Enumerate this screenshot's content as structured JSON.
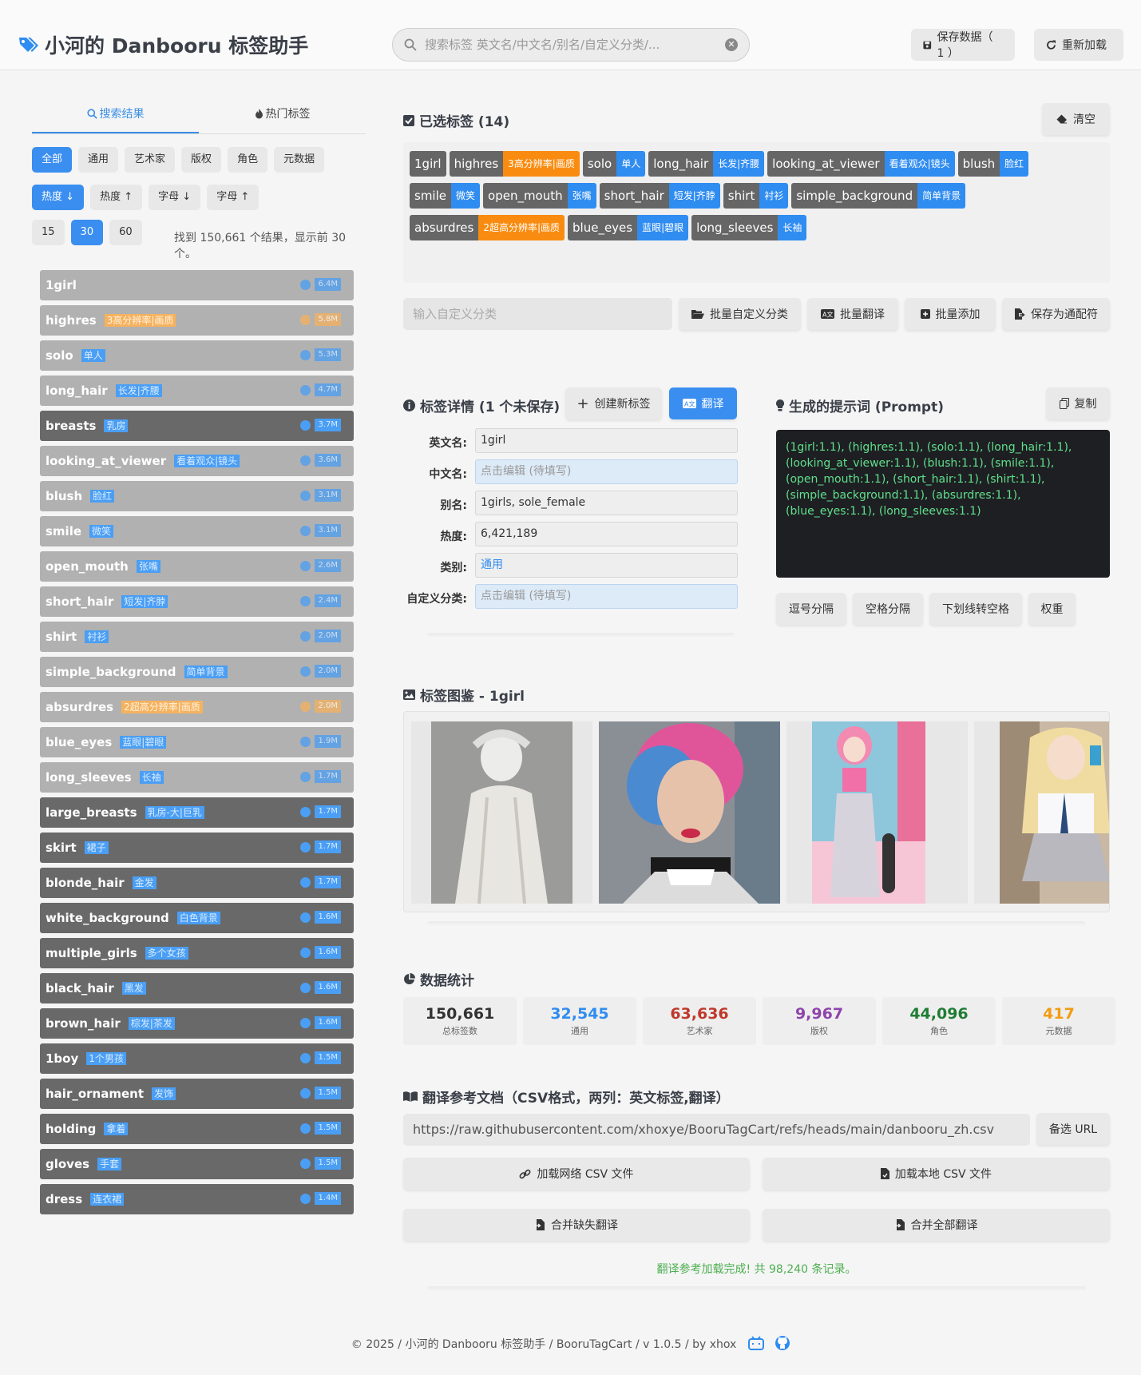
{
  "header": {
    "title": "小河的 Danbooru 标签助手",
    "search_placeholder": "搜索标签 英文名/中文名/别名/自定义分类/...",
    "save_label": "保存数据（ 1 ）",
    "reload_label": "重新加载"
  },
  "left": {
    "tabs": [
      "搜索结果",
      "热门标签"
    ],
    "categories": [
      "全部",
      "通用",
      "艺术家",
      "版权",
      "角色",
      "元数据"
    ],
    "sorts": [
      "热度",
      "热度",
      "字母",
      "字母"
    ],
    "page_sizes": [
      "15",
      "30",
      "60"
    ],
    "found_text": "找到 150,661 个结果，显示前 30 个。",
    "items": [
      {
        "en": "1girl",
        "zh": "",
        "count": "6.4M",
        "style": "light",
        "meta": false
      },
      {
        "en": "highres",
        "zh": "3高分辨率|画质",
        "count": "5.8M",
        "style": "light",
        "meta": true
      },
      {
        "en": "solo",
        "zh": "单人",
        "count": "5.3M",
        "style": "light",
        "meta": false
      },
      {
        "en": "long_hair",
        "zh": "长发|齐腰",
        "count": "4.7M",
        "style": "light",
        "meta": false
      },
      {
        "en": "breasts",
        "zh": "乳房",
        "count": "3.7M",
        "style": "dark",
        "meta": false
      },
      {
        "en": "looking_at_viewer",
        "zh": "看着观众|镜头",
        "count": "3.6M",
        "style": "light",
        "meta": false
      },
      {
        "en": "blush",
        "zh": "脸红",
        "count": "3.1M",
        "style": "light",
        "meta": false
      },
      {
        "en": "smile",
        "zh": "微笑",
        "count": "3.1M",
        "style": "light",
        "meta": false
      },
      {
        "en": "open_mouth",
        "zh": "张嘴",
        "count": "2.6M",
        "style": "light",
        "meta": false
      },
      {
        "en": "short_hair",
        "zh": "短发|齐脖",
        "count": "2.4M",
        "style": "light",
        "meta": false
      },
      {
        "en": "shirt",
        "zh": "衬衫",
        "count": "2.0M",
        "style": "light",
        "meta": false
      },
      {
        "en": "simple_background",
        "zh": "简单背景",
        "count": "2.0M",
        "style": "light",
        "meta": false
      },
      {
        "en": "absurdres",
        "zh": "2超高分辨率|画质",
        "count": "2.0M",
        "style": "light",
        "meta": true
      },
      {
        "en": "blue_eyes",
        "zh": "蓝眼|碧眼",
        "count": "1.9M",
        "style": "light",
        "meta": false
      },
      {
        "en": "long_sleeves",
        "zh": "长袖",
        "count": "1.7M",
        "style": "light",
        "meta": false
      },
      {
        "en": "large_breasts",
        "zh": "乳房-大|巨乳",
        "count": "1.7M",
        "style": "dark",
        "meta": false
      },
      {
        "en": "skirt",
        "zh": "裙子",
        "count": "1.7M",
        "style": "dark",
        "meta": false
      },
      {
        "en": "blonde_hair",
        "zh": "金发",
        "count": "1.7M",
        "style": "dark",
        "meta": false
      },
      {
        "en": "white_background",
        "zh": "白色背景",
        "count": "1.6M",
        "style": "dark",
        "meta": false
      },
      {
        "en": "multiple_girls",
        "zh": "多个女孩",
        "count": "1.6M",
        "style": "dark",
        "meta": false
      },
      {
        "en": "black_hair",
        "zh": "黑发",
        "count": "1.6M",
        "style": "dark",
        "meta": false
      },
      {
        "en": "brown_hair",
        "zh": "棕发|茶发",
        "count": "1.6M",
        "style": "dark",
        "meta": false
      },
      {
        "en": "1boy",
        "zh": "1个男孩",
        "count": "1.5M",
        "style": "dark",
        "meta": false
      },
      {
        "en": "hair_ornament",
        "zh": "发饰",
        "count": "1.5M",
        "style": "dark",
        "meta": false
      },
      {
        "en": "holding",
        "zh": "拿着",
        "count": "1.5M",
        "style": "dark",
        "meta": false
      },
      {
        "en": "gloves",
        "zh": "手套",
        "count": "1.5M",
        "style": "dark",
        "meta": false
      },
      {
        "en": "dress",
        "zh": "连衣裙",
        "count": "1.4M",
        "style": "dark",
        "meta": false
      }
    ]
  },
  "selected": {
    "title": "已选标签 (14)",
    "clear_label": "清空",
    "tags": [
      {
        "en": "1girl",
        "zh": "",
        "meta": false
      },
      {
        "en": "highres",
        "zh": "3高分辨率|画质",
        "meta": true
      },
      {
        "en": "solo",
        "zh": "单人",
        "meta": false
      },
      {
        "en": "long_hair",
        "zh": "长发|齐腰",
        "meta": false
      },
      {
        "en": "looking_at_viewer",
        "zh": "看着观众|镜头",
        "meta": false
      },
      {
        "en": "blush",
        "zh": "脸红",
        "meta": false
      },
      {
        "en": "smile",
        "zh": "微笑",
        "meta": false
      },
      {
        "en": "open_mouth",
        "zh": "张嘴",
        "meta": false
      },
      {
        "en": "short_hair",
        "zh": "短发|齐脖",
        "meta": false
      },
      {
        "en": "shirt",
        "zh": "衬衫",
        "meta": false
      },
      {
        "en": "simple_background",
        "zh": "简单背景",
        "meta": false
      },
      {
        "en": "absurdres",
        "zh": "2超高分辨率|画质",
        "meta": true
      },
      {
        "en": "blue_eyes",
        "zh": "蓝眼|碧眼",
        "meta": false
      },
      {
        "en": "long_sleeves",
        "zh": "长袖",
        "meta": false
      }
    ],
    "custom_placeholder": "输入自定义分类",
    "btn_batch_custom": "批量自定义分类",
    "btn_batch_translate": "批量翻译",
    "btn_batch_add": "批量添加",
    "btn_save_wildcard": "保存为通配符"
  },
  "detail": {
    "title": "标签详情 (1 个未保存)",
    "create_label": "创建新标签",
    "translate_label": "翻译",
    "labels": [
      "英文名:",
      "中文名:",
      "别名:",
      "热度:",
      "类别:",
      "自定义分类:"
    ],
    "values": [
      "1girl",
      "点击编辑 (待填写)",
      "1girls, sole_female",
      "6,421,189",
      "通用",
      "点击编辑 (待填写)"
    ]
  },
  "prompt": {
    "title": "生成的提示词 (Prompt)",
    "copy_label": "复制",
    "text": "(1girl:1.1), (highres:1.1), (solo:1.1), (long_hair:1.1), (looking_at_viewer:1.1), (blush:1.1), (smile:1.1), (open_mouth:1.1), (short_hair:1.1), (shirt:1.1), (simple_background:1.1), (absurdres:1.1), (blue_eyes:1.1), (long_sleeves:1.1)",
    "formats": [
      "逗号分隔",
      "空格分隔",
      "下划线转空格",
      "权重"
    ]
  },
  "gallery": {
    "title": "标签图鉴 - 1girl"
  },
  "stats": {
    "title": "数据统计",
    "items": [
      {
        "n": "150,661",
        "l": "总标签数",
        "color": "#333333"
      },
      {
        "n": "32,545",
        "l": "通用",
        "color": "#2f8cf0"
      },
      {
        "n": "63,636",
        "l": "艺术家",
        "color": "#c0392b"
      },
      {
        "n": "9,967",
        "l": "版权",
        "color": "#8e44ad"
      },
      {
        "n": "44,096",
        "l": "角色",
        "color": "#1e7e34"
      },
      {
        "n": "417",
        "l": "元数据",
        "color": "#f39c12"
      }
    ]
  },
  "translate_doc": {
    "title": "翻译参考文档（CSV格式，两列：英文标签,翻译）",
    "url": "https://raw.githubusercontent.com/xhoxye/BooruTagCart/refs/heads/main/danbooru_zh.csv",
    "alt_url_label": "备选 URL",
    "load_net": "加载网络 CSV 文件",
    "load_local": "加载本地 CSV 文件",
    "merge_missing": "合并缺失翻译",
    "merge_all": "合并全部翻译",
    "status": "翻译参考加载完成! 共 98,240 条记录。"
  },
  "footer": {
    "text": "© 2025 / 小河的 Danbooru 标签助手 / BooruTagCart / v 1.0.5 / by xhox"
  }
}
